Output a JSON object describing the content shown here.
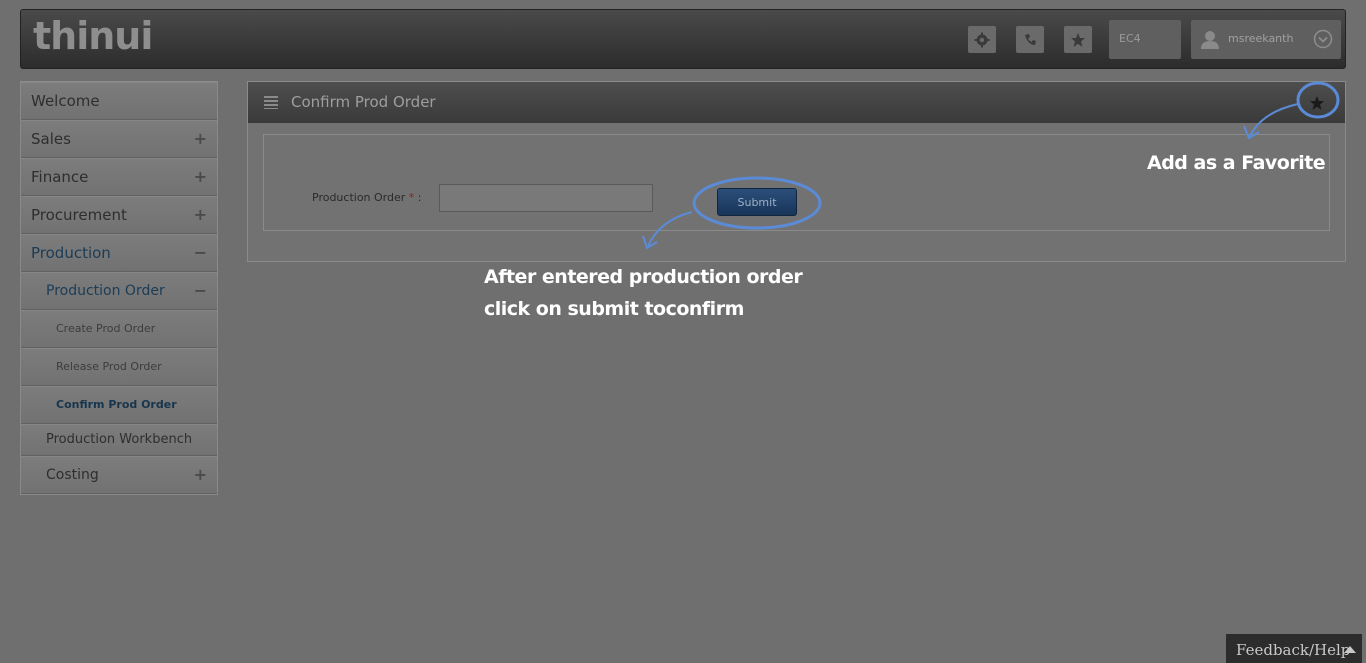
{
  "header": {
    "logo": "thinui",
    "icons": [
      "gear-icon",
      "phone-icon",
      "star-icon"
    ],
    "client": "EC4",
    "user": "msreekanth"
  },
  "sidebar": {
    "items": [
      {
        "label": "Welcome"
      },
      {
        "label": "Sales",
        "toggle": "+"
      },
      {
        "label": "Finance",
        "toggle": "+"
      },
      {
        "label": "Procurement",
        "toggle": "+"
      },
      {
        "label": "Production",
        "toggle": "−"
      },
      {
        "label": "Production Order",
        "toggle": "−"
      },
      {
        "label": "Create Prod Order"
      },
      {
        "label": "Release Prod Order"
      },
      {
        "label": "Confirm Prod Order"
      },
      {
        "label": "Production Workbench"
      },
      {
        "label": "Costing",
        "toggle": "+"
      }
    ]
  },
  "panel": {
    "title": "Confirm Prod Order",
    "field_label": "Production Order",
    "required_mark": "*",
    "label_suffix": ":",
    "field_value": "",
    "submit_label": "Submit"
  },
  "annotations": {
    "favorite": "Add as a Favorite",
    "instruction_line1": "After entered production order",
    "instruction_line2": "click on submit toconfirm"
  },
  "footer": {
    "feedback": "Feedback/Help"
  },
  "colors": {
    "accent_blue": "#5b8bd6",
    "button_blue": "#1f4068"
  }
}
